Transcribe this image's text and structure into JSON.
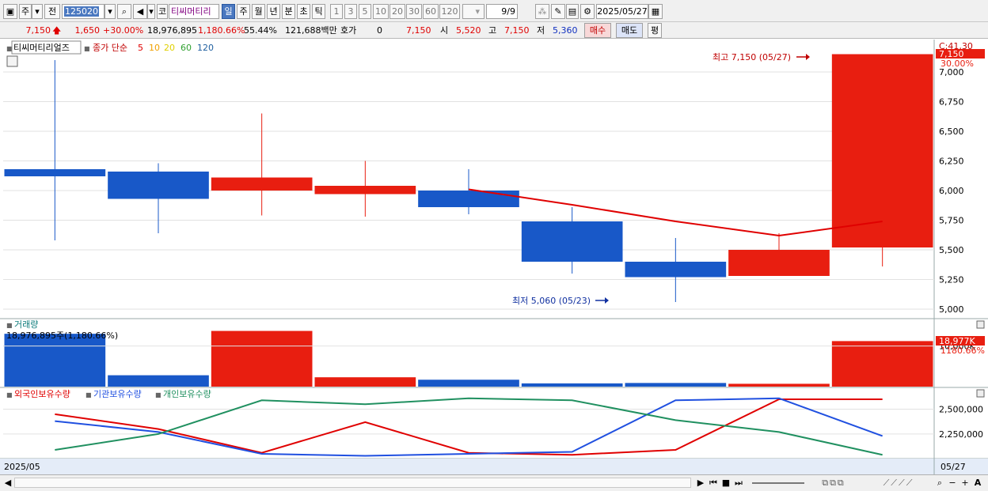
{
  "toolbar": {
    "btn_ju": "주",
    "btn_jeon": "전",
    "code": "125020",
    "name_prefix": "코",
    "name": "티씨머티리",
    "periods": [
      "일",
      "주",
      "월",
      "년",
      "분",
      "초",
      "틱"
    ],
    "minutes": [
      "1",
      "3",
      "5",
      "10",
      "20",
      "30",
      "60",
      "120"
    ],
    "count": "9/9",
    "date": "2025/05/27"
  },
  "quote": {
    "price": "7,150",
    "change": "1,650",
    "rate": "+30.00%",
    "volume": "18,976,895",
    "vol_rate": "1,180.66%",
    "ratio": "55.44%",
    "amount": "121,688백만",
    "hoga_label": "호가",
    "hoga_value": "0",
    "hoga_price": "7,150",
    "open_label": "시",
    "open": "5,520",
    "high_label": "고",
    "high": "7,150",
    "low_label": "저",
    "low": "5,360",
    "buy_label": "매수",
    "sell_label": "매도",
    "avg_label": "평"
  },
  "price_pane": {
    "title": "티씨머티리얼즈",
    "legend_prefix": "종가 단순",
    "ma": [
      "5",
      "10",
      "20",
      "60",
      "120"
    ],
    "ma_colors": [
      "#e00000",
      "#f0a000",
      "#e0d000",
      "#30a030",
      "#2060a0"
    ],
    "yticks": [
      "7,000",
      "6,750",
      "6,500",
      "6,250",
      "6,000",
      "5,750",
      "5,500",
      "5,250",
      "5,000"
    ],
    "cursor_tag": "C:41,30",
    "price_tag": "7,150",
    "rate_tag": "30.00%",
    "high_note": "최고 7,150 (05/27)",
    "low_note": "최저 5,060 (05/23)"
  },
  "volume_pane": {
    "title": "거래량",
    "value_label": "18,976,895주(1,180.66%)",
    "tag": "18,977K",
    "tag_rate": "1180.66%",
    "ytick": "10,000K"
  },
  "holdings_pane": {
    "legend": [
      "외국인보유수량",
      "기관보유수량",
      "개인보유수량"
    ],
    "colors": [
      "#e00000",
      "#2050e0",
      "#209060"
    ],
    "yticks": [
      "2,500,000",
      "2,250,000"
    ]
  },
  "x_axis": {
    "left": "2025/05",
    "right": "05/27"
  },
  "chart_data": [
    {
      "type": "candlestick",
      "title": "티씨머티리얼즈",
      "ylim": [
        4940,
        7200
      ],
      "ohlc": [
        {
          "open": 6180,
          "high": 7100,
          "low": 5580,
          "close": 6120
        },
        {
          "open": 6160,
          "high": 6230,
          "low": 5640,
          "close": 5930
        },
        {
          "open": 6000,
          "high": 6650,
          "low": 5790,
          "close": 6110
        },
        {
          "open": 5970,
          "high": 6250,
          "low": 5780,
          "close": 6040
        },
        {
          "open": 6000,
          "high": 6180,
          "low": 5800,
          "close": 5860
        },
        {
          "open": 5740,
          "high": 5860,
          "low": 5300,
          "close": 5400
        },
        {
          "open": 5400,
          "high": 5600,
          "low": 5060,
          "close": 5270
        },
        {
          "open": 5280,
          "high": 5640,
          "low": 5280,
          "close": 5500
        },
        {
          "open": 5520,
          "high": 7150,
          "low": 5360,
          "close": 7150
        }
      ],
      "ma5": [
        null,
        null,
        null,
        null,
        6010,
        5880,
        5740,
        5620,
        5740
      ]
    },
    {
      "type": "bar",
      "title": "거래량",
      "values": [
        13000000,
        2800000,
        13700000,
        2300000,
        1700000,
        800000,
        900000,
        700000,
        11200000
      ],
      "colors": [
        "blue",
        "blue",
        "red",
        "red",
        "blue",
        "blue",
        "blue",
        "red",
        "red"
      ]
    },
    {
      "type": "line",
      "series": [
        {
          "name": "외국인보유수량",
          "values": [
            2450000,
            2300000,
            2060000,
            2370000,
            2060000,
            2040000,
            2090000,
            2600000,
            2600000
          ]
        },
        {
          "name": "기관보유수량",
          "values": [
            2380000,
            2270000,
            2050000,
            2030000,
            2050000,
            2070000,
            2590000,
            2610000,
            2230000
          ]
        },
        {
          "name": "개인보유수량",
          "values": [
            2090000,
            2250000,
            2590000,
            2550000,
            2610000,
            2590000,
            2390000,
            2270000,
            2040000
          ]
        }
      ]
    }
  ]
}
